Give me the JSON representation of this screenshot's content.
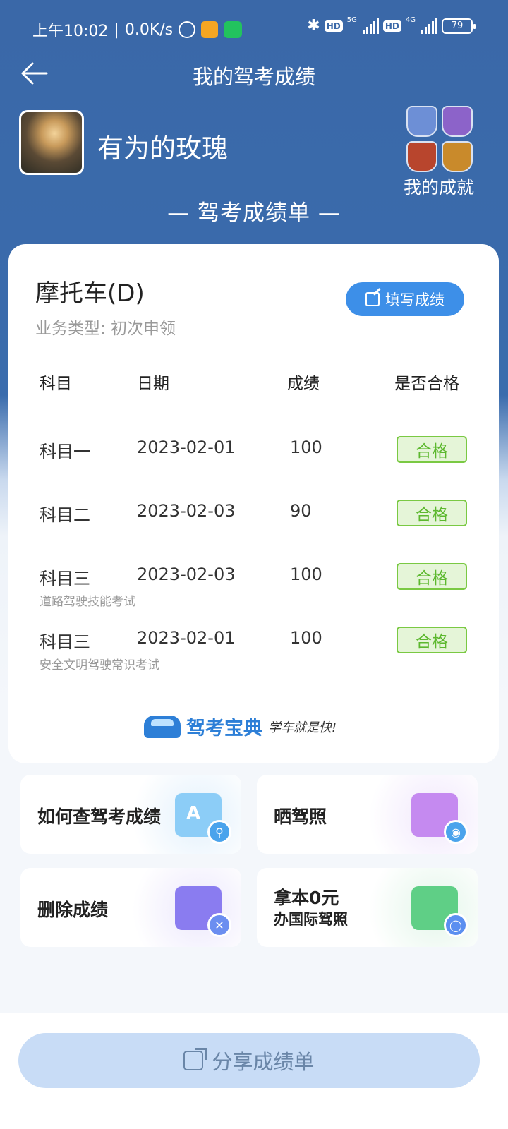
{
  "status_bar": {
    "time": "上午10:02",
    "net_speed": "0.0K/s",
    "separator": "|",
    "sim1_label": "5G",
    "sim2_label": "4G",
    "hd": "HD",
    "battery": "79"
  },
  "nav": {
    "title": "我的驾考成绩"
  },
  "profile": {
    "username": "有为的玫瑰",
    "achievements_label": "我的成就",
    "badge_colors": [
      "#6d8fd6",
      "#8c63c9",
      "#b8452d",
      "#c98a2b"
    ]
  },
  "report_title": "— 驾考成绩单 —",
  "card": {
    "vehicle": "摩托车(D)",
    "business_type": "业务类型: 初次申领",
    "fill_button": "填写成绩",
    "headers": {
      "subject": "科目",
      "date": "日期",
      "score": "成绩",
      "pass": "是否合格"
    },
    "rows": [
      {
        "subject": "科目一",
        "date": "2023-02-01",
        "score": "100",
        "status": "合格",
        "sub": ""
      },
      {
        "subject": "科目二",
        "date": "2023-02-03",
        "score": "90",
        "status": "合格",
        "sub": ""
      },
      {
        "subject": "科目三",
        "date": "2023-02-03",
        "score": "100",
        "status": "合格",
        "sub": "道路驾驶技能考试"
      },
      {
        "subject": "科目三",
        "date": "2023-02-01",
        "score": "100",
        "status": "合格",
        "sub": "安全文明驾驶常识考试"
      }
    ],
    "logo_text": "驾考宝典",
    "logo_slogan": "学车就是快!"
  },
  "tiles": [
    {
      "label": "如何查驾考成绩",
      "icon": "query-icon",
      "color": "#5aaef0"
    },
    {
      "label": "晒驾照",
      "icon": "photo-icon",
      "color": "#b77ce8"
    },
    {
      "label": "删除成绩",
      "icon": "delete-icon",
      "color": "#7b6ce8"
    },
    {
      "label_line1": "拿本0元",
      "label_line2": "办国际驾照",
      "icon": "license-icon",
      "color": "#4cc37a"
    }
  ],
  "share_button": "分享成绩单",
  "colors": {
    "header_blue": "#3a68a8",
    "button_blue": "#3d8fe8",
    "pass_green": "#7ac943"
  }
}
